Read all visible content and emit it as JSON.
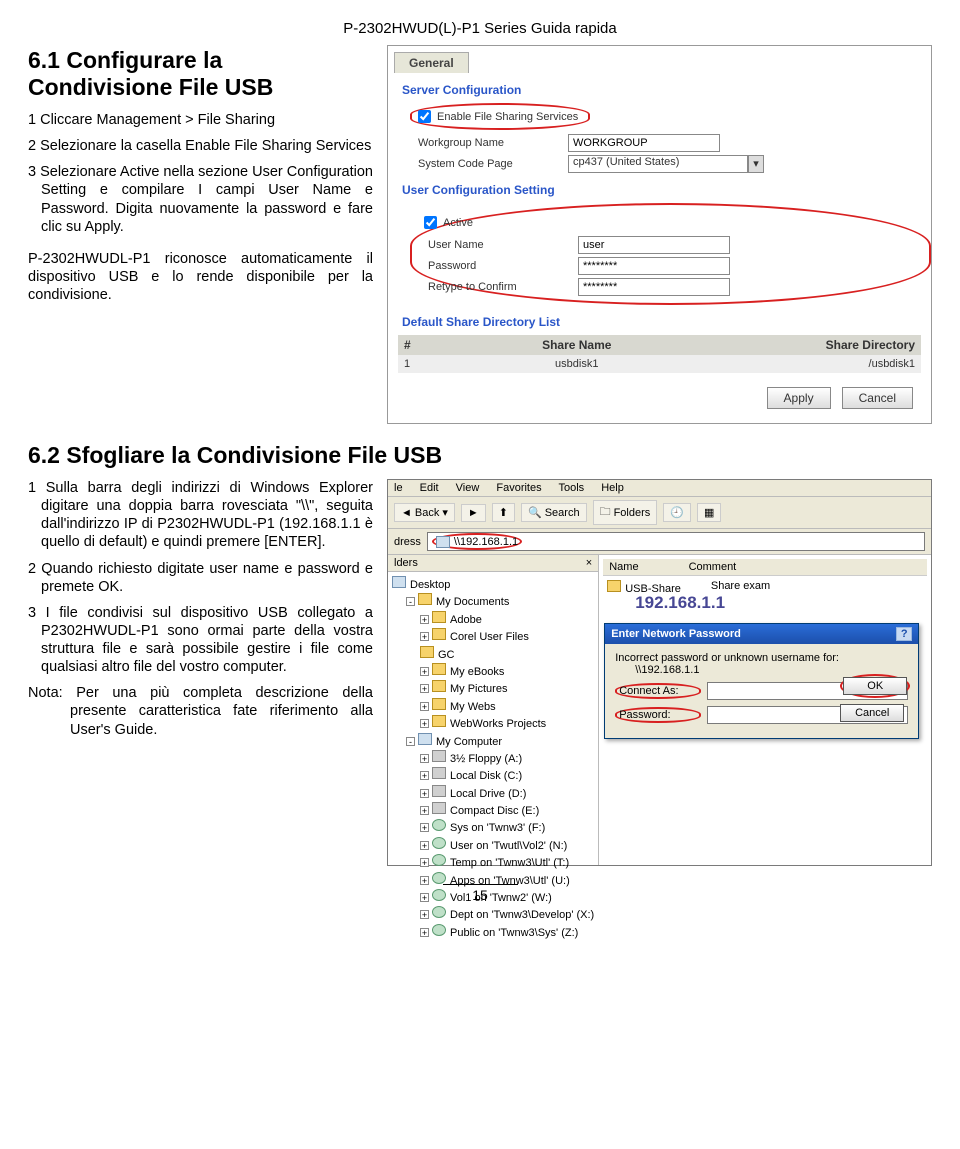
{
  "doc": {
    "header": "P-2302HWUD(L)-P1 Series Guida rapida",
    "page_number": "15"
  },
  "section61": {
    "title": "6.1 Configurare la Condivisione File USB",
    "steps": [
      "1 Cliccare Management > File Sharing",
      "2 Selezionare la casella Enable File Sharing Services",
      "3 Selezionare Active nella sezione User Configuration Setting e compilare I campi User Name e Password. Digita nuovamente la password e fare clic su Apply."
    ],
    "para": "P-2302HWUDL-P1 riconosce automaticamente il dispositivo USB e lo rende disponibile per la condivisione."
  },
  "panel": {
    "tab": "General",
    "sc_label": "Server Configuration",
    "enable_cb": "Enable File Sharing Services",
    "workgroup_label": "Workgroup Name",
    "workgroup_value": "WORKGROUP",
    "codepage_label": "System Code Page",
    "codepage_value": "cp437 (United States)",
    "ucs_label": "User Configuration Setting",
    "active_cb": "Active",
    "username_label": "User Name",
    "username_value": "user",
    "password_label": "Password",
    "password_value": "********",
    "retype_label": "Retype to Confirm",
    "retype_value": "********",
    "list_label": "Default Share Directory List",
    "th_idx": "#",
    "th_name": "Share Name",
    "th_dir": "Share Directory",
    "row_idx": "1",
    "row_name": "usbdisk1",
    "row_dir": "/usbdisk1",
    "btn_apply": "Apply",
    "btn_cancel": "Cancel"
  },
  "section62": {
    "title": "6.2 Sfogliare la Condivisione File USB",
    "steps": [
      "1 Sulla barra degli indirizzi di Windows Explorer digitare una doppia barra rovesciata \"\\\\\", seguita dall'indirizzo IP di P2302HWUDL-P1 (192.168.1.1 è quello di default) e quindi premere [ENTER].",
      "2 Quando richiesto digitate user name e password e premete OK.",
      "3 I file condivisi sul dispositivo USB collegato a P2302HWUDL-P1 sono ormai parte della vostra struttura file e sarà possibile gestire i file come qualsiasi altro file del vostro computer."
    ],
    "note": "Nota: Per una più completa descrizione della presente caratteristica fate riferimento alla User's Guide."
  },
  "explorer": {
    "menus": [
      "le",
      "Edit",
      "View",
      "Favorites",
      "Tools",
      "Help"
    ],
    "back": "Back",
    "search": "Search",
    "folders": "Folders",
    "address_label": "dress",
    "address_value": "\\\\192.168.1.1",
    "folders_title": "lders",
    "tree": {
      "desktop": "Desktop",
      "mydocs": "My Documents",
      "items1": [
        "Adobe",
        "Corel User Files",
        "GC",
        "My eBooks",
        "My Pictures",
        "My Webs",
        "WebWorks Projects"
      ],
      "mycomp": "My Computer",
      "drives": [
        "3½ Floppy (A:)",
        "Local Disk (C:)",
        "Local Drive (D:)",
        "Compact Disc (E:)",
        "Sys on 'Twnw3' (F:)",
        "User on 'Twutl\\Vol2' (N:)",
        "Temp on 'Twnw3\\Utl' (T:)",
        "Apps on 'Twnw3\\Utl' (U:)",
        "Vol1 on 'Twnw2' (W:)",
        "Dept on 'Twnw3\\Develop' (X:)",
        "Public on 'Twnw3\\Sys' (Z:)"
      ]
    },
    "files_head": [
      "Name",
      "Comment"
    ],
    "usb_item": "USB-Share",
    "usb_comment": "Share exam",
    "big_ip": "192.168.1.1"
  },
  "dialog": {
    "title": "Enter Network Password",
    "msg1": "Incorrect password or unknown username for:",
    "msg2": "\\\\192.168.1.1",
    "connect_label": "Connect As:",
    "password_label": "Password:",
    "ok": "OK",
    "cancel": "Cancel"
  }
}
